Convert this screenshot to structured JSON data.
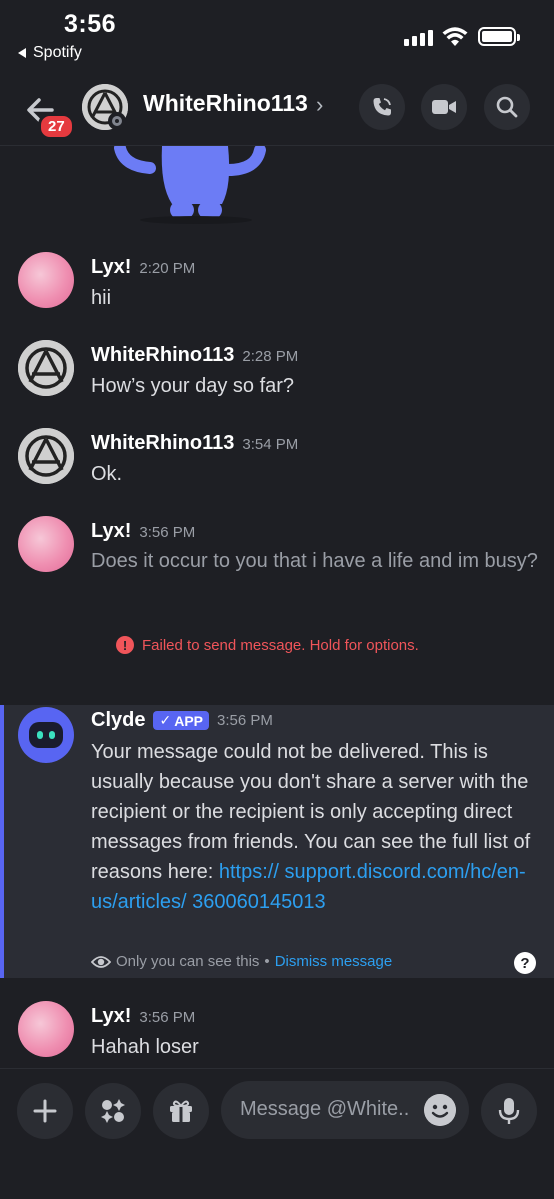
{
  "status_bar": {
    "time": "3:56",
    "back_app": "Spotify"
  },
  "header": {
    "unread_badge": "27",
    "contact_name": "WhiteRhino113",
    "chevron": "›"
  },
  "messages": [
    {
      "author": "Lyx!",
      "time": "2:20 PM",
      "text": "hii"
    },
    {
      "author": "WhiteRhino113",
      "time": "2:28 PM",
      "text": "How’s your day so far?"
    },
    {
      "author": "WhiteRhino113",
      "time": "3:54 PM",
      "text": "Ok."
    },
    {
      "author": "Lyx!",
      "time": "3:56 PM",
      "text": "Does it occur to you that i have a life and im busy?"
    }
  ],
  "failed_notice": {
    "icon": "!",
    "text": "Failed to send message. Hold for options."
  },
  "clyde": {
    "author": "Clyde",
    "tag_check": "✓",
    "tag": "APP",
    "time": "3:56 PM",
    "text": "Your message could not be delivered. This is usually because you don't share a server with the recipient or the recipient is only accepting direct messages from friends. You can see the full list of reasons here: ",
    "link": "https:// support.discord.com/hc/en-us/articles/ 360060145013",
    "visibility": "Only you can see this",
    "separator": "•",
    "dismiss": "Dismiss message",
    "help": "?"
  },
  "last_message": {
    "author": "Lyx!",
    "time": "3:56 PM",
    "text": "Hahah loser"
  },
  "composer": {
    "placeholder": "Message @White.."
  },
  "colors": {
    "background": "#1e1f24",
    "accent": "#5865f2",
    "error": "#f0555a",
    "link": "#2c9ff0",
    "badge": "#e53a3f"
  }
}
